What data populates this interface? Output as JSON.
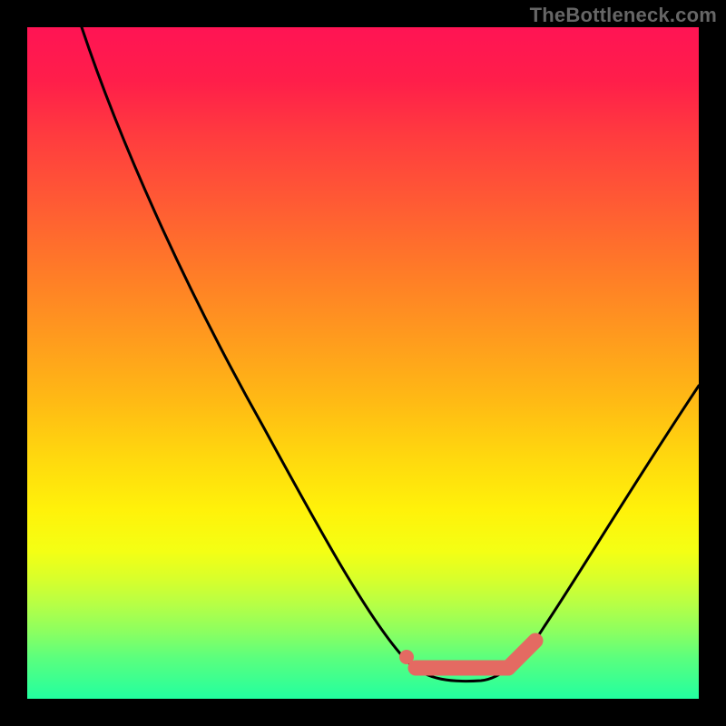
{
  "watermark": "TheBottleneck.com",
  "colors": {
    "background": "#000000",
    "watermark": "#666666",
    "curve": "#000000",
    "marker": "#e46a62"
  },
  "chart_data": {
    "type": "line",
    "title": "",
    "xlabel": "",
    "ylabel": "",
    "xlim": [
      0,
      100
    ],
    "ylim": [
      0,
      100
    ],
    "grid": false,
    "series": [
      {
        "name": "main-curve",
        "x": [
          0,
          8,
          16,
          24,
          32,
          40,
          48,
          54,
          58,
          62,
          66,
          68,
          72,
          76,
          80,
          84,
          88,
          92,
          96,
          100
        ],
        "values": [
          100,
          89,
          78,
          67,
          56,
          45,
          33,
          22,
          14,
          8,
          3,
          2,
          2,
          3,
          5,
          10,
          18,
          27,
          37,
          48
        ]
      }
    ],
    "annotations": [
      {
        "name": "marker-dot",
        "x": 56,
        "y": 6,
        "shape": "dot"
      },
      {
        "name": "marker-segment",
        "x0": 58,
        "y0": 4,
        "x1": 72,
        "y1": 4,
        "shape": "thick-line"
      },
      {
        "name": "marker-hook",
        "x0": 72,
        "y0": 4,
        "x1": 76,
        "y1": 8,
        "shape": "thick-line"
      }
    ]
  }
}
